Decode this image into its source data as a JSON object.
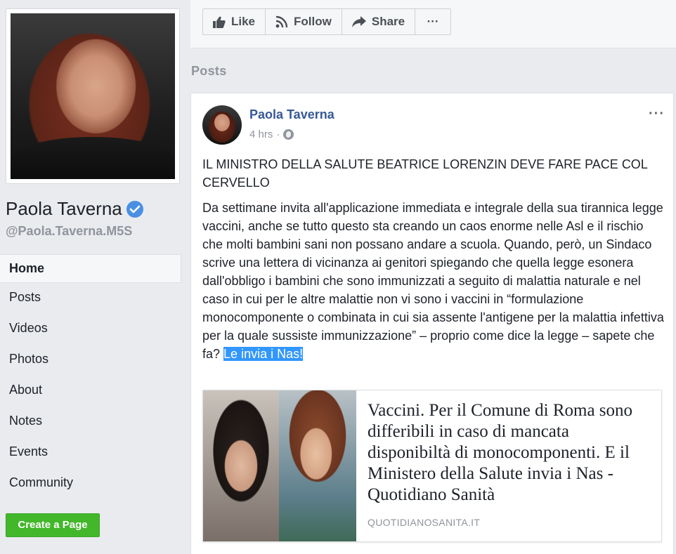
{
  "profile": {
    "name": "Paola Taverna",
    "handle": "@Paola.Taverna.M5S"
  },
  "nav": {
    "items": [
      {
        "label": "Home",
        "active": true
      },
      {
        "label": "Posts"
      },
      {
        "label": "Videos"
      },
      {
        "label": "Photos"
      },
      {
        "label": "About"
      },
      {
        "label": "Notes"
      },
      {
        "label": "Events"
      },
      {
        "label": "Community"
      }
    ],
    "create_page_label": "Create a Page"
  },
  "actions": {
    "like_label": "Like",
    "follow_label": "Follow",
    "share_label": "Share",
    "more_label": "···"
  },
  "posts_heading": "Posts",
  "post": {
    "author": "Paola Taverna",
    "time": "4 hrs",
    "separator": "·",
    "options_label": "···",
    "headline": "IL MINISTRO DELLA SALUTE BEATRICE LORENZIN DEVE FARE PACE COL CERVELLO",
    "paragraph": "Da settimane invita all'applicazione immediata e integrale della sua tirannica legge vaccini, anche se tutto questo sta creando un caos enorme nelle Asl e il rischio che molti bambini sani non possano andare a scuola. Quando, però, un Sindaco scrive una lettera di vicinanza ai genitori spiegando che quella legge esonera dall'obbligo i bambini che sono immunizzati a seguito di malattia naturale e nel caso in cui per le altre malattie non vi sono i vaccini in “formulazione monocomponente o combinata in cui sia assente l'antigene per la malattia infettiva per la quale sussiste immunizzazione” – proprio come dice la legge – sapete che fa?",
    "highlight": "Le invia i Nas!",
    "link": {
      "title": "Vaccini. Per il Comune di Roma sono differibili in caso di mancata disponibiltà di monocomponenti. E il Ministero della Salute invia i Nas - Quotidiano Sanità",
      "domain": "QUOTIDIANOSANITA.IT"
    }
  },
  "colors": {
    "background": "#e9ebee",
    "link_blue": "#365899",
    "verified_blue": "#4a90e2",
    "create_green": "#42b72a",
    "highlight_blue": "#3297fd"
  }
}
